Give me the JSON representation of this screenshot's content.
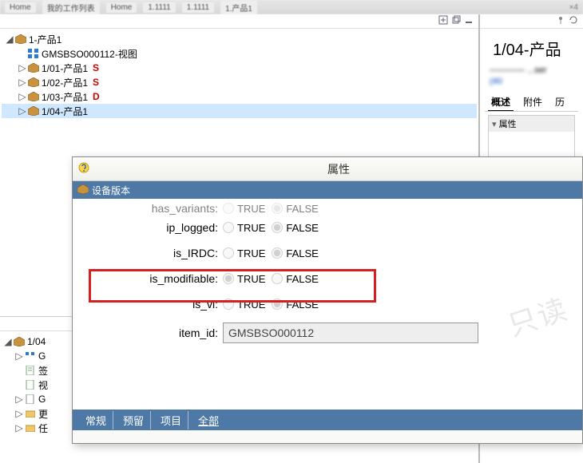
{
  "top_tabs": {
    "home": "Home",
    "myspace": "我的工作列表",
    "home2": "Home",
    "t1": "1.1111",
    "t2": "1.1111",
    "t_current": "1.产品1",
    "close_x": "×4"
  },
  "tree": {
    "root": {
      "label": "1-产品1"
    },
    "view_node": {
      "label": "GMSBSO000112-视图"
    },
    "a1": {
      "label": "1/01-产品1",
      "suffix": "S"
    },
    "a2": {
      "label": "1/02-产品1",
      "suffix": "S"
    },
    "a3": {
      "label": "1/03-产品1",
      "suffix": "D"
    },
    "a4": {
      "label": "1/04-产品1"
    }
  },
  "lower_tree": {
    "root": {
      "label": "1/04"
    },
    "g": {
      "label": "G"
    },
    "sig": {
      "label": "签"
    },
    "vw": {
      "label": "视"
    },
    "g2": {
      "label": "G"
    },
    "more": {
      "label": "更"
    },
    "attr": {
      "label": "任"
    }
  },
  "right": {
    "title": "1/04-产品",
    "meta_line1": "———— ...ser",
    "meta_link": "(40",
    "tabs": {
      "summary": "概述",
      "attach": "附件",
      "history": "历"
    },
    "section_props": "属性"
  },
  "dialog": {
    "title": "属性",
    "subtitle": "设备版本",
    "radio_true": "TRUE",
    "radio_false": "FALSE",
    "rows": {
      "has_variants": {
        "label": "has_variants:",
        "value": "FALSE"
      },
      "ip_logged": {
        "label": "ip_logged:",
        "value": "FALSE"
      },
      "is_IRDC": {
        "label": "is_IRDC:",
        "value": "FALSE"
      },
      "is_modifiable": {
        "label": "is_modifiable:",
        "value": "TRUE"
      },
      "is_vi": {
        "label": "is_vi:",
        "value": "FALSE"
      },
      "item_id": {
        "label": "item_id:",
        "value": "GMSBSO000112"
      }
    },
    "tabs": {
      "general": "常规",
      "reserve": "预留",
      "project": "项目",
      "all": "全部"
    },
    "watermark": "只读"
  },
  "colors": {
    "accent_blue": "#4e79a6",
    "highlight_red": "#d62020"
  }
}
